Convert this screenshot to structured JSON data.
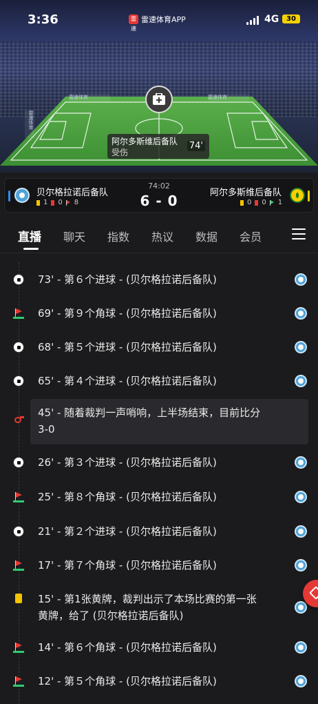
{
  "status_bar": {
    "time": "3:36",
    "app_name": "雷速体育APP",
    "app_logo_text": "雷速",
    "network": "4G",
    "battery": "30"
  },
  "hero": {
    "sponsors": [
      "雷速体育",
      "雷速体育",
      "雷速体育"
    ],
    "event_popup": {
      "team": "阿尔多斯维后备队",
      "type": "受伤",
      "minute": "74'"
    }
  },
  "match": {
    "clock": "74:02",
    "score": "6 - 0",
    "home": {
      "name": "贝尔格拉诺后备队",
      "yellow": "1",
      "red": "0",
      "corners": "8",
      "color": "#2d8cf0"
    },
    "away": {
      "name": "阿尔多斯维后备队",
      "yellow": "0",
      "red": "0",
      "corners": "1",
      "color": "#f5d100"
    }
  },
  "tabs": [
    "直播",
    "聊天",
    "指数",
    "热议",
    "数据",
    "会员"
  ],
  "active_tab": "直播",
  "timeline": [
    {
      "icon": "goal-ball-icon",
      "text": "73' - 第６个进球 - (贝尔格拉诺后备队)"
    },
    {
      "icon": "corner-flag-icon",
      "text": "69' - 第９个角球 - (贝尔格拉诺后备队)"
    },
    {
      "icon": "goal-ball-icon",
      "text": "68' - 第５个进球 - (贝尔格拉诺后备队)"
    },
    {
      "icon": "goal-ball-icon",
      "text": "65' - 第４个进球 - (贝尔格拉诺后备队)"
    },
    {
      "icon": "whistle-icon",
      "text_line1": "45' - 随着裁判一声哨响，上半场结束，目前比分",
      "text_line2": "3-0"
    },
    {
      "icon": "goal-ball-icon",
      "text": "26' - 第３个进球 - (贝尔格拉诺后备队)"
    },
    {
      "icon": "corner-flag-icon",
      "text": "25' - 第８个角球 - (贝尔格拉诺后备队)"
    },
    {
      "icon": "goal-ball-icon",
      "text": "21' - 第２个进球 - (贝尔格拉诺后备队)"
    },
    {
      "icon": "corner-flag-icon",
      "text": "17' - 第７个角球 - (贝尔格拉诺后备队)"
    },
    {
      "icon": "yellow-card-icon",
      "text_line1": "15' - 第1张黄牌，裁判出示了本场比赛的第一张",
      "text_line2": "黄牌，给了 (贝尔格拉诺后备队)"
    },
    {
      "icon": "corner-flag-icon",
      "text": "14' - 第６个角球 - (贝尔格拉诺后备队)"
    },
    {
      "icon": "corner-flag-icon",
      "text": "12' - 第５个角球 - (贝尔格拉诺后备队)"
    }
  ]
}
